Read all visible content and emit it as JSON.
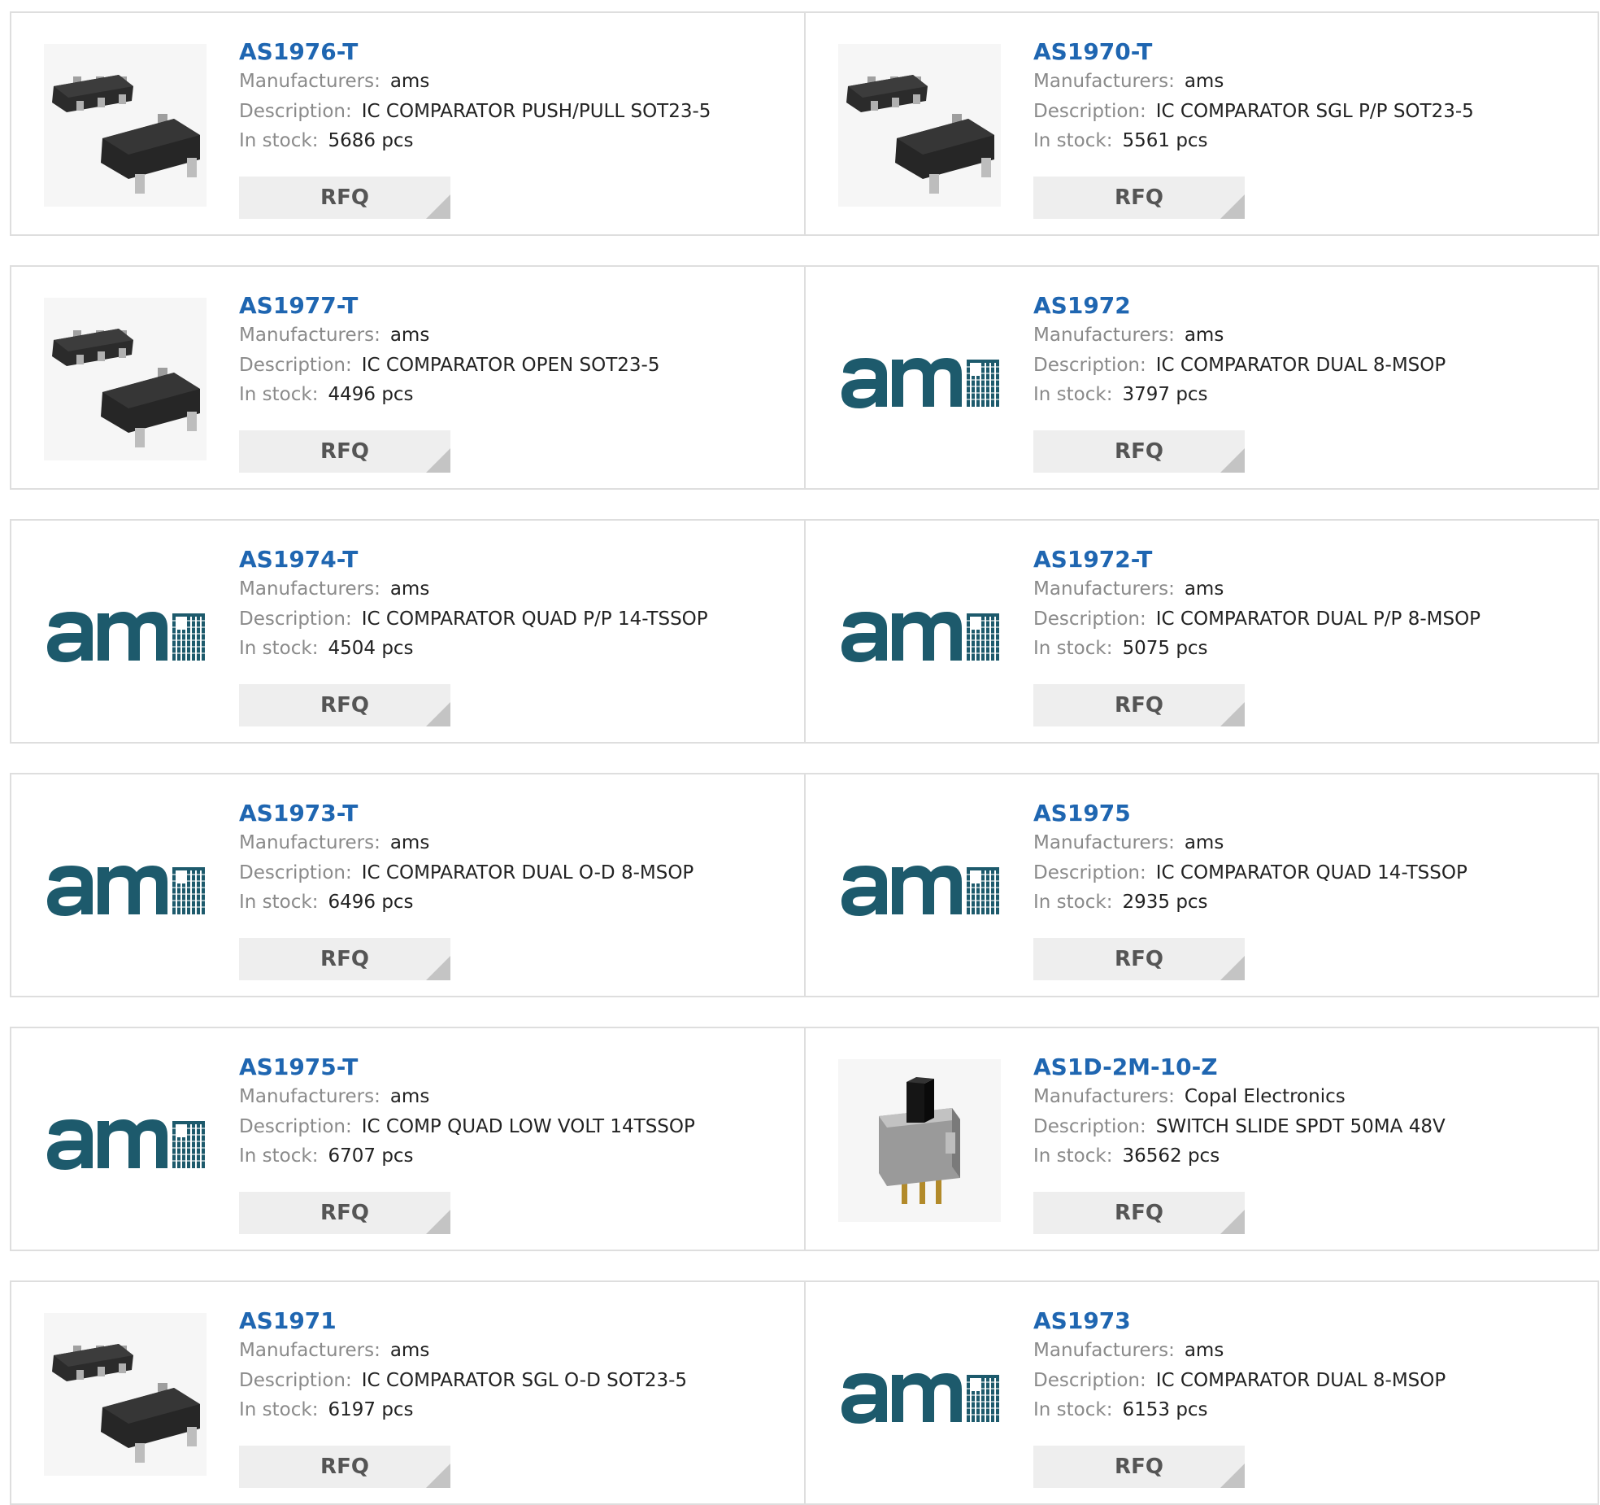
{
  "labels": {
    "manufacturers": "Manufacturers:",
    "description": "Description:",
    "in_stock": "In stock:"
  },
  "products": [
    {
      "part": "AS1976-T",
      "manufacturer": "ams",
      "description": "IC COMPARATOR PUSH/PULL SOT23-5",
      "stock": "5686 pcs",
      "image": "sot23-icon",
      "rfq": "RFQ"
    },
    {
      "part": "AS1970-T",
      "manufacturer": "ams",
      "description": "IC COMPARATOR SGL P/P SOT23-5",
      "stock": "5561 pcs",
      "image": "sot23-icon",
      "rfq": "RFQ"
    },
    {
      "part": "AS1977-T",
      "manufacturer": "ams",
      "description": "IC COMPARATOR OPEN SOT23-5",
      "stock": "4496 pcs",
      "image": "sot23-icon",
      "rfq": "RFQ"
    },
    {
      "part": "AS1972",
      "manufacturer": "ams",
      "description": "IC COMPARATOR DUAL 8-MSOP",
      "stock": "3797 pcs",
      "image": "ams-logo",
      "rfq": "RFQ"
    },
    {
      "part": "AS1974-T",
      "manufacturer": "ams",
      "description": "IC COMPARATOR QUAD P/P 14-TSSOP",
      "stock": "4504 pcs",
      "image": "ams-logo",
      "rfq": "RFQ"
    },
    {
      "part": "AS1972-T",
      "manufacturer": "ams",
      "description": "IC COMPARATOR DUAL P/P 8-MSOP",
      "stock": "5075 pcs",
      "image": "ams-logo",
      "rfq": "RFQ"
    },
    {
      "part": "AS1973-T",
      "manufacturer": "ams",
      "description": "IC COMPARATOR DUAL O-D 8-MSOP",
      "stock": "6496 pcs",
      "image": "ams-logo",
      "rfq": "RFQ"
    },
    {
      "part": "AS1975",
      "manufacturer": "ams",
      "description": "IC COMPARATOR QUAD 14-TSSOP",
      "stock": "2935 pcs",
      "image": "ams-logo",
      "rfq": "RFQ"
    },
    {
      "part": "AS1975-T",
      "manufacturer": "ams",
      "description": "IC COMP QUAD LOW VOLT 14TSSOP",
      "stock": "6707 pcs",
      "image": "ams-logo",
      "rfq": "RFQ"
    },
    {
      "part": "AS1D-2M-10-Z",
      "manufacturer": "Copal Electronics",
      "description": "SWITCH SLIDE SPDT 50MA 48V",
      "stock": "36562 pcs",
      "image": "slide-switch-icon",
      "rfq": "RFQ"
    },
    {
      "part": "AS1971",
      "manufacturer": "ams",
      "description": "IC COMPARATOR SGL O-D SOT23-5",
      "stock": "6197 pcs",
      "image": "sot23-icon",
      "rfq": "RFQ"
    },
    {
      "part": "AS1973",
      "manufacturer": "ams",
      "description": "IC COMPARATOR DUAL 8-MSOP",
      "stock": "6153 pcs",
      "image": "ams-logo",
      "rfq": "RFQ"
    }
  ],
  "colors": {
    "part_link": "#1f66b1",
    "label_gray": "#8a8a8a",
    "ams_logo": "#1d5a6c",
    "rfq_bg": "#eeeeee",
    "border": "#dedede"
  }
}
